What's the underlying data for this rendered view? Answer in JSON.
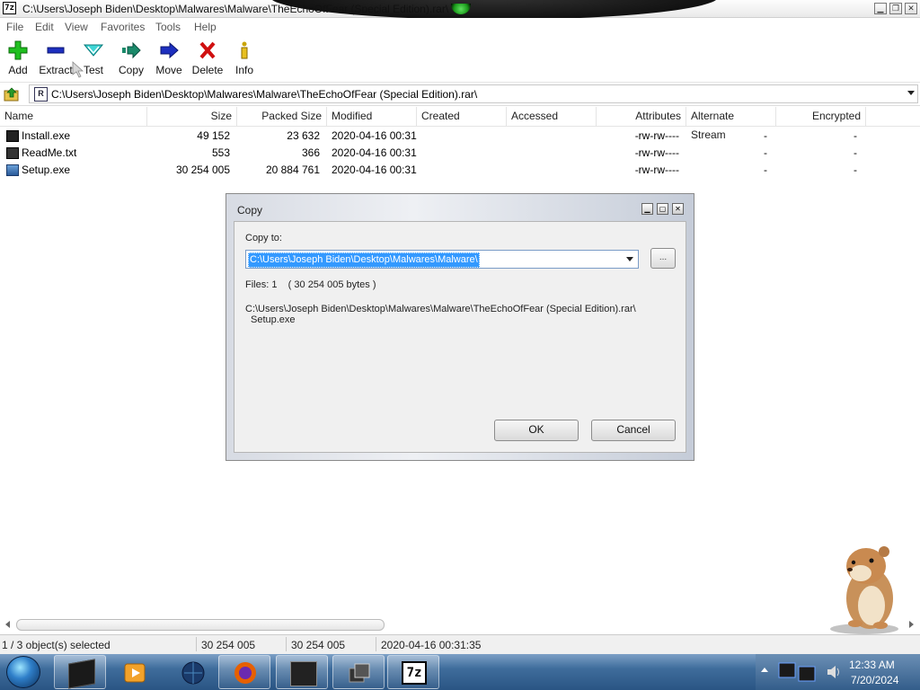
{
  "window": {
    "title": "C:\\Users\\Joseph Biden\\Desktop\\Malwares\\Malware\\TheEchoOfFear (Special Edition).rar\\",
    "app_icon_text": "7z"
  },
  "menu": [
    "File",
    "Edit",
    "View",
    "Favorites",
    "Tools",
    "Help"
  ],
  "toolbar": {
    "buttons": [
      {
        "label": "Add",
        "icon": "add-icon"
      },
      {
        "label": "Extract",
        "icon": "extract-icon"
      },
      {
        "label": "Test",
        "icon": "test-icon"
      },
      {
        "label": "Copy",
        "icon": "copy-icon"
      },
      {
        "label": "Move",
        "icon": "move-icon"
      },
      {
        "label": "Delete",
        "icon": "delete-icon"
      },
      {
        "label": "Info",
        "icon": "info-icon"
      }
    ]
  },
  "address": {
    "path": "C:\\Users\\Joseph Biden\\Desktop\\Malwares\\Malware\\TheEchoOfFear (Special Edition).rar\\"
  },
  "columns": [
    "Name",
    "Size",
    "Packed Size",
    "Modified",
    "Created",
    "Accessed",
    "Attributes",
    "Alternate Stream",
    "Encrypted"
  ],
  "files": [
    {
      "name": "Install.exe",
      "size": "49 152",
      "packed": "23 632",
      "modified": "2020-04-16 00:31",
      "created": "",
      "accessed": "",
      "attributes": "-rw-rw----",
      "alt_stream": "-",
      "encrypted": "-"
    },
    {
      "name": "ReadMe.txt",
      "size": "553",
      "packed": "366",
      "modified": "2020-04-16 00:31",
      "created": "",
      "accessed": "",
      "attributes": "-rw-rw----",
      "alt_stream": "-",
      "encrypted": "-"
    },
    {
      "name": "Setup.exe",
      "size": "30 254 005",
      "packed": "20 884 761",
      "modified": "2020-04-16 00:31",
      "created": "",
      "accessed": "",
      "attributes": "-rw-rw----",
      "alt_stream": "-",
      "encrypted": "-"
    }
  ],
  "status": {
    "selection": "1 / 3 object(s) selected",
    "size": "30 254 005",
    "packed": "30 254 005",
    "modified": "2020-04-16 00:31:35"
  },
  "dialog": {
    "title": "Copy",
    "copy_to_label": "Copy to:",
    "path_value": "C:\\Users\\Joseph Biden\\Desktop\\Malwares\\Malware\\",
    "browse_label": "...",
    "files_info": "Files: 1    ( 30 254 005 bytes )",
    "source_path": "C:\\Users\\Joseph Biden\\Desktop\\Malwares\\Malware\\TheEchoOfFear (Special Edition).rar\\",
    "source_file": "Setup.exe",
    "ok_label": "OK",
    "cancel_label": "Cancel"
  },
  "taskbar": {
    "time": "12:33 AM",
    "date": "7/20/2024",
    "pinned_7z_label": "7z"
  }
}
